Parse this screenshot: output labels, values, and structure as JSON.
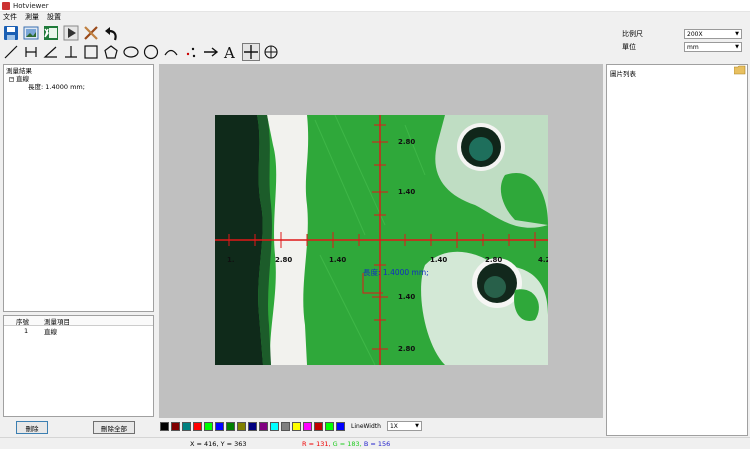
{
  "window": {
    "title": "Hotviewer"
  },
  "menu": [
    "文件",
    "測量",
    "設置"
  ],
  "toolbar": {
    "row1": [
      {
        "name": "save-icon",
        "color": "#1a5fb4"
      },
      {
        "name": "open-image-icon",
        "color": "#3a6fb0"
      },
      {
        "name": "excel-export-icon",
        "color": "#1f7a3a"
      },
      {
        "name": "play-icon",
        "color": "#333333"
      },
      {
        "name": "clear-icon",
        "color": "#9a4a1a"
      },
      {
        "name": "undo-icon",
        "color": "#111111"
      }
    ],
    "row2": [
      "line-tool-icon",
      "parallel-line-tool-icon",
      "angle-tool-icon",
      "perpendicular-tool-icon",
      "rectangle-tool-icon",
      "polygon-tool-icon",
      "ellipse-tool-icon",
      "circle-tool-icon",
      "arc-tool-icon",
      "points-tool-icon",
      "arrow-tool-icon",
      "text-tool-icon",
      "crosshair-tool-icon",
      "target-tool-icon"
    ],
    "text_tool_glyph": "A"
  },
  "scale": {
    "ratio_label": "比例尺",
    "ratio_value": "200X",
    "unit_label": "單位",
    "unit_value": "mm"
  },
  "results": {
    "root": "測量結果",
    "item": "直線",
    "detail": "長度: 1.4000 mm;"
  },
  "grid": {
    "col_index": "序號",
    "col_item": "測量項目",
    "rows": [
      {
        "index": "1",
        "item": "直線"
      }
    ]
  },
  "buttons": {
    "delete": "刪除",
    "delete_all": "刪除全部"
  },
  "image": {
    "h_labels": [
      "2.80",
      "1.40",
      "1.40",
      "2.80",
      "4.2"
    ],
    "h_label_edge": "1.",
    "v_labels": [
      "2.80",
      "1.40",
      "1.40",
      "2.80"
    ],
    "measurement": "長度: 1.4000 mm;",
    "colors": {
      "board": "#2fa83a",
      "pad": "#f2f2ee",
      "dark": "#0f2a1a",
      "ruler": "#e01818",
      "measure": "#1030c0"
    }
  },
  "palette": {
    "colors": [
      "#000000",
      "#800000",
      "#008080",
      "#ff0000",
      "#00ff00",
      "#0000ff",
      "#008000",
      "#808000",
      "#000080",
      "#800080",
      "#00ffff",
      "#808080",
      "#ffff00",
      "#ff00ff",
      "#c00000",
      "#00ff00",
      "#0000ff"
    ],
    "linewidth_label": "LineWidth",
    "linewidth_value": "1X"
  },
  "right_panel": {
    "title": "圖片列表"
  },
  "status": {
    "coords": "X = 416, Y = 363",
    "r": "R = 131,",
    "g": "G = 183,",
    "b": "B = 156"
  }
}
